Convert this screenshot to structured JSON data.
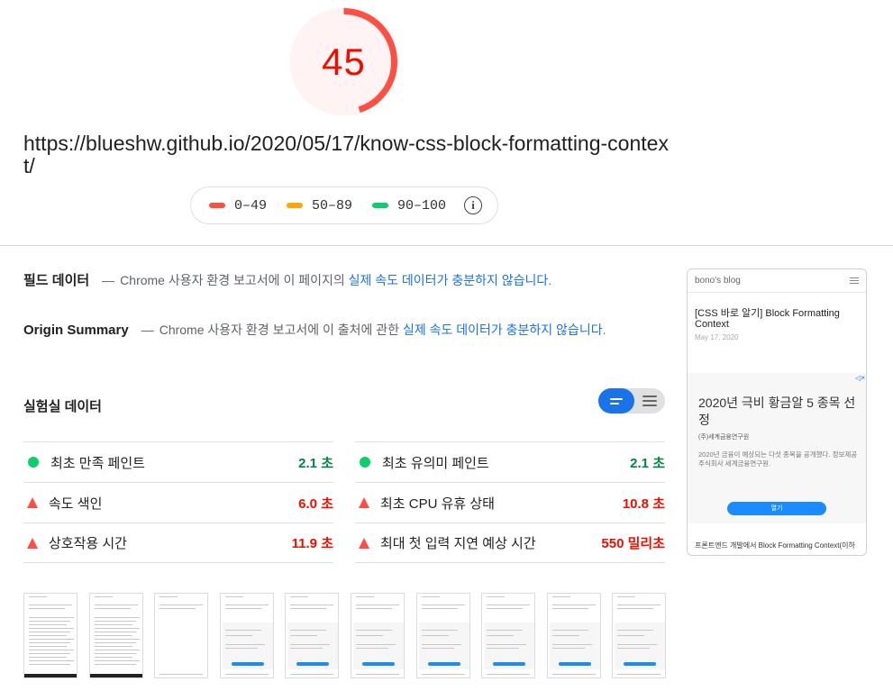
{
  "score": {
    "value": "45",
    "fraction": 0.45,
    "color": "#eb0f00",
    "arc_color": "#ff4e42",
    "bg_color": "#fff3f3"
  },
  "url": "https://blueshw.github.io/2020/05/17/know-css-block-formatting-context/",
  "legend": [
    {
      "label": "0–49",
      "color": "#ff4e42"
    },
    {
      "label": "50–89",
      "color": "#ffa400"
    },
    {
      "label": "90–100",
      "color": "#0cce6b"
    }
  ],
  "legend_info_icon": "info-icon",
  "field_data": {
    "title": "필드 데이터",
    "dash": "—",
    "text": "Chrome 사용자 환경 보고서에 이 페이지의",
    "link": "실제 속도 데이터가 충분하지 않습니다."
  },
  "origin_summary": {
    "title": "Origin Summary",
    "dash": "—",
    "text": "Chrome 사용자 환경 보고서에 이 출처에 관한",
    "link": "실제 속도 데이터가 충분하지 않습니다."
  },
  "lab_data": {
    "title": "실험실 데이터",
    "left": [
      {
        "label": "최초 만족 페인트",
        "value": "2.1 초",
        "status": "pass"
      },
      {
        "label": "속도 색인",
        "value": "6.0 초",
        "status": "fail"
      },
      {
        "label": "상호작용 시간",
        "value": "11.9 초",
        "status": "fail"
      }
    ],
    "right": [
      {
        "label": "최초 유의미 페인트",
        "value": "2.1 초",
        "status": "pass"
      },
      {
        "label": "최초 CPU 유휴 상태",
        "value": "10.8 초",
        "status": "fail"
      },
      {
        "label": "최대 첫 입력 지연 예상 시간",
        "value": "550 밀리초",
        "status": "fail"
      }
    ]
  },
  "screenshot": {
    "blog_name": "bono's blog",
    "post_title": "[CSS 바로 알기] Block Formatting Context",
    "post_date": "May 17, 2020",
    "ad_title": "2020년 극비 황금알 5 종목 선정",
    "ad_sub": "(주)세계금융연구원",
    "ad_desc": "2020년 금융이 예상되는 다섯 종목을 공개했다. 정보제공 주식회사 세계금융연구원.",
    "ad_button": "열기",
    "ad_mark": "◁×",
    "footer": "프론트엔드 개발에서 Block Formatting Context(이하"
  },
  "thumbnails_count": 10
}
